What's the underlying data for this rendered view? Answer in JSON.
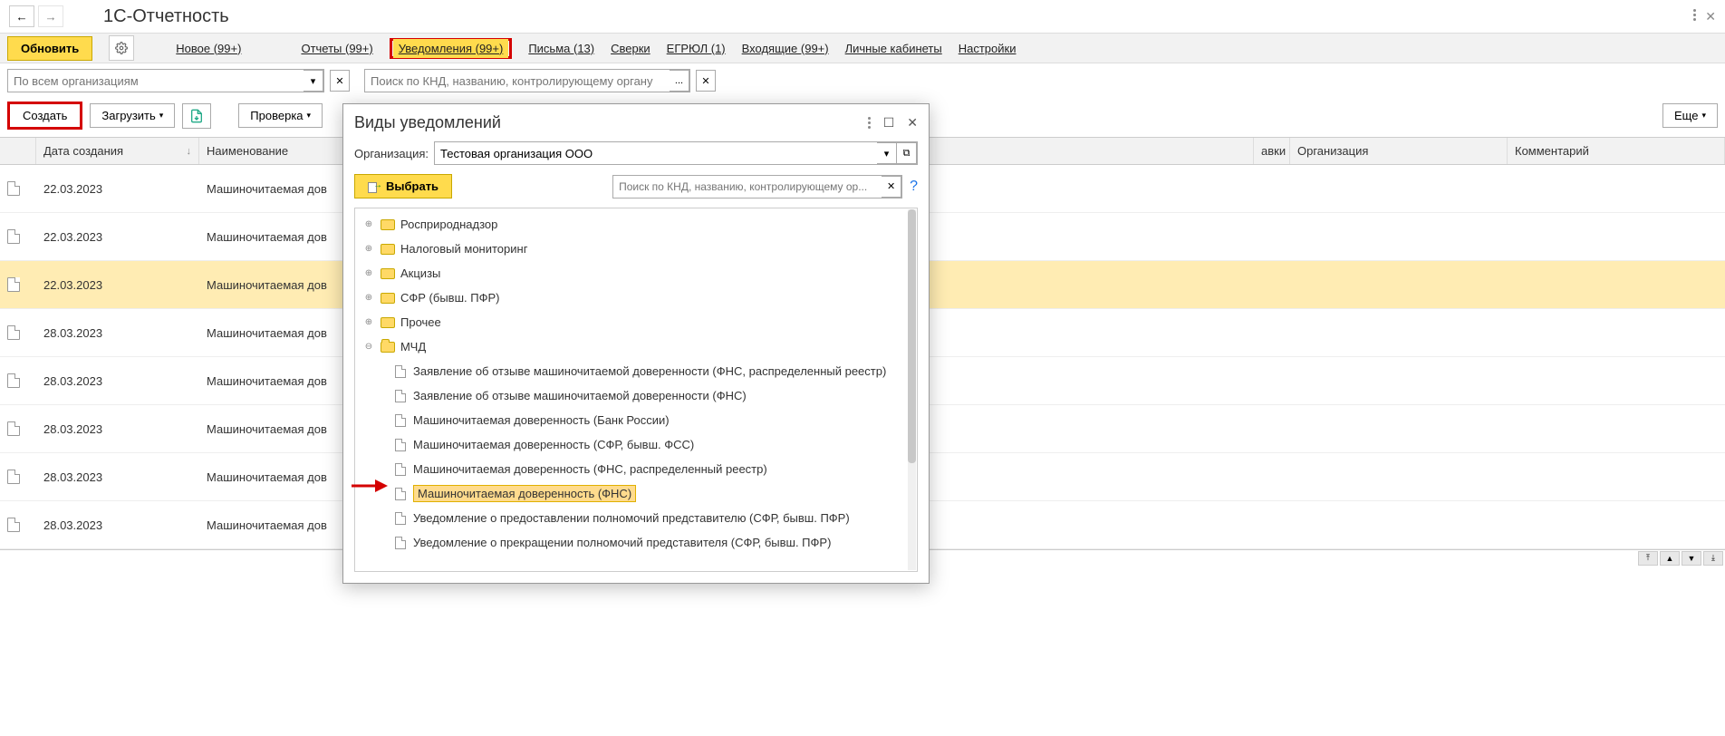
{
  "page_title": "1С-Отчетность",
  "toolbar": {
    "refresh": "Обновить",
    "new": "Новое (99+)",
    "reports": "Отчеты (99+)",
    "notifications": "Уведомления (99+)",
    "letters": "Письма (13)",
    "reconciliations": "Сверки",
    "egrul": "ЕГРЮЛ (1)",
    "incoming": "Входящие (99+)",
    "cabinets": "Личные кабинеты",
    "settings": "Настройки"
  },
  "filters": {
    "org_placeholder": "По всем организациям",
    "search_placeholder": "Поиск по КНД, названию, контролирующему органу",
    "ellipsis": "..."
  },
  "actions": {
    "create": "Создать",
    "load": "Загрузить",
    "check": "Проверка",
    "more": "Еще"
  },
  "table": {
    "headers": {
      "date": "Дата создания",
      "name": "Наименование",
      "avki": "авки",
      "org": "Организация",
      "comment": "Комментарий"
    },
    "rows": [
      {
        "date": "22.03.2023",
        "name": "Машиночитаемая дов",
        "selected": false
      },
      {
        "date": "22.03.2023",
        "name": "Машиночитаемая дов",
        "selected": false
      },
      {
        "date": "22.03.2023",
        "name": "Машиночитаемая дов",
        "selected": true
      },
      {
        "date": "28.03.2023",
        "name": "Машиночитаемая дов",
        "selected": false
      },
      {
        "date": "28.03.2023",
        "name": "Машиночитаемая дов",
        "selected": false
      },
      {
        "date": "28.03.2023",
        "name": "Машиночитаемая дов",
        "selected": false
      },
      {
        "date": "28.03.2023",
        "name": "Машиночитаемая дов",
        "selected": false
      },
      {
        "date": "28.03.2023",
        "name": "Машиночитаемая дов",
        "selected": false
      }
    ]
  },
  "modal": {
    "title": "Виды уведомлений",
    "org_label": "Организация:",
    "org_value": "Тестовая организация ООО",
    "select_btn": "Выбрать",
    "search_placeholder": "Поиск по КНД, названию, контролирующему ор...",
    "tree": {
      "folders": [
        {
          "label": "Росприроднадзор",
          "expandable": true
        },
        {
          "label": "Налоговый мониторинг",
          "expandable": true
        },
        {
          "label": "Акцизы",
          "expandable": true
        },
        {
          "label": "СФР (бывш. ПФР)",
          "expandable": true
        },
        {
          "label": "Прочее",
          "expandable": true
        },
        {
          "label": "МЧД",
          "expandable": true,
          "open": true
        }
      ],
      "leaves": [
        {
          "label": "Заявление об отзыве машиночитаемой доверенности (ФНС, распределенный реестр)"
        },
        {
          "label": "Заявление об отзыве машиночитаемой доверенности (ФНС)"
        },
        {
          "label": "Машиночитаемая доверенность (Банк России)"
        },
        {
          "label": "Машиночитаемая доверенность (СФР, бывш. ФСС)"
        },
        {
          "label": "Машиночитаемая доверенность (ФНС, распределенный реестр)"
        },
        {
          "label": "Машиночитаемая доверенность (ФНС)",
          "highlighted": true
        },
        {
          "label": "Уведомление о предоставлении полномочий представителю (СФР, бывш. ПФР)"
        },
        {
          "label": "Уведомление о прекращении полномочий представителя (СФР, бывш. ПФР)"
        }
      ]
    }
  }
}
